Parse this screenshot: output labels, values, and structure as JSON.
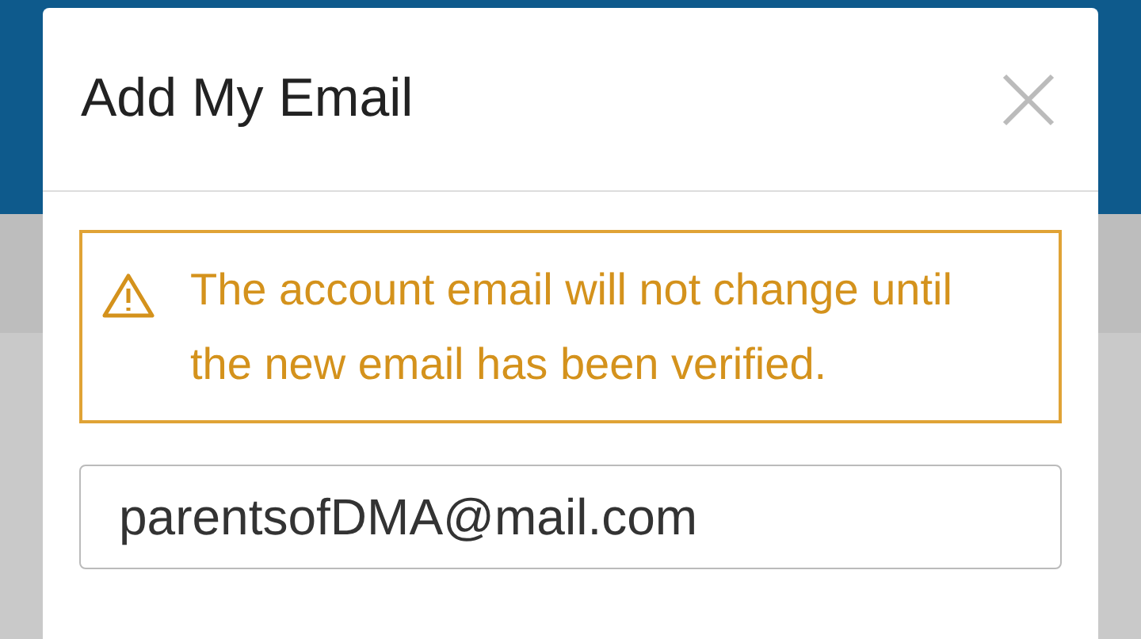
{
  "dialog": {
    "title": "Add My Email"
  },
  "warning": {
    "text": "The account email will not change until the new email has been verified."
  },
  "email_field": {
    "value": "parentsofDMA@mail.com"
  }
}
